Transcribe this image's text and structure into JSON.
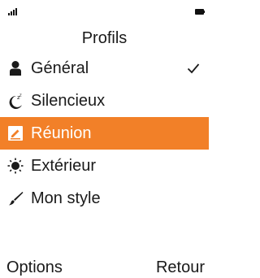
{
  "status_bar": {
    "signal_icon": "signal-bars-icon",
    "battery_icon": "battery-icon"
  },
  "header": {
    "title": "Profils"
  },
  "profiles": {
    "items": [
      {
        "label": "Général",
        "icon": "person-icon",
        "active": true
      },
      {
        "label": "Silencieux",
        "icon": "moon-sleep-icon"
      },
      {
        "label": "Réunion",
        "icon": "meeting-note-icon",
        "selected": true
      },
      {
        "label": "Extérieur",
        "icon": "sun-icon"
      },
      {
        "label": "Mon style",
        "icon": "brush-icon"
      }
    ],
    "active_indicator_icon": "checkmark-icon"
  },
  "softkeys": {
    "left": "Options",
    "right": "Retour"
  },
  "colors": {
    "highlight": "#f28028",
    "text": "#1a1a1a",
    "background": "#ffffff"
  }
}
